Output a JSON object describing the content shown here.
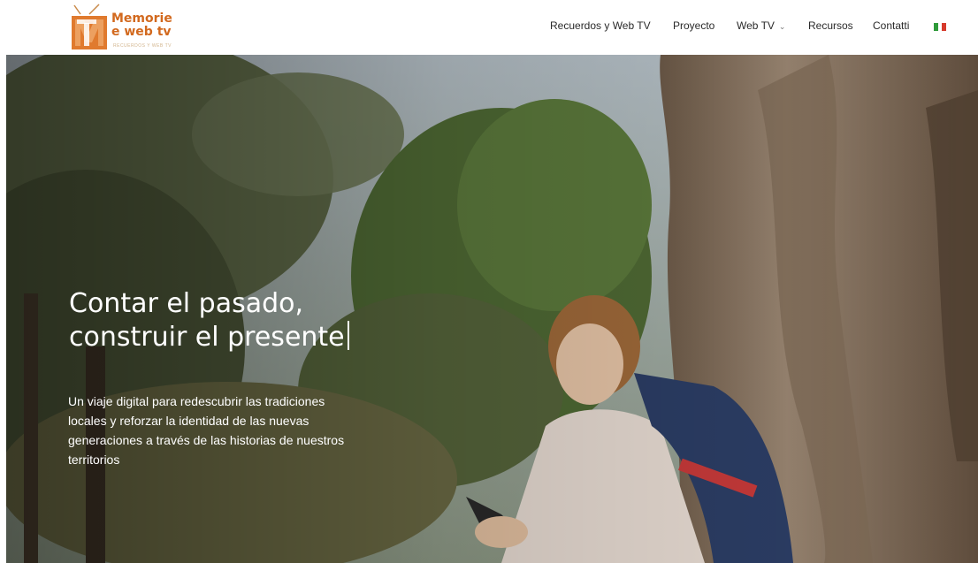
{
  "brand": {
    "name_line1": "Memorie",
    "name_line2": "e web tv",
    "tagline": "RECUERDOS Y WEB TV"
  },
  "nav": {
    "items": [
      {
        "label": "Recuerdos y Web TV"
      },
      {
        "label": "Proyecto"
      },
      {
        "label": "Web TV",
        "has_dropdown": true
      },
      {
        "label": "Recursos"
      },
      {
        "label": "Contatti"
      }
    ],
    "language_flag": "italian-flag-icon"
  },
  "hero": {
    "title_line1": "Contar el pasado,",
    "title_line2": "construir el presente",
    "description": "Un viaje digital para redescubrir las tradiciones locales y reforzar la identidad de las nuevas generaciones a través de las historias de nuestros territorios"
  },
  "colors": {
    "brand_orange": "#d2691e",
    "nav_text": "#2a2a2a",
    "flag_green": "#2e9a3a",
    "flag_white": "#ffffff",
    "flag_red": "#d63a2c"
  }
}
